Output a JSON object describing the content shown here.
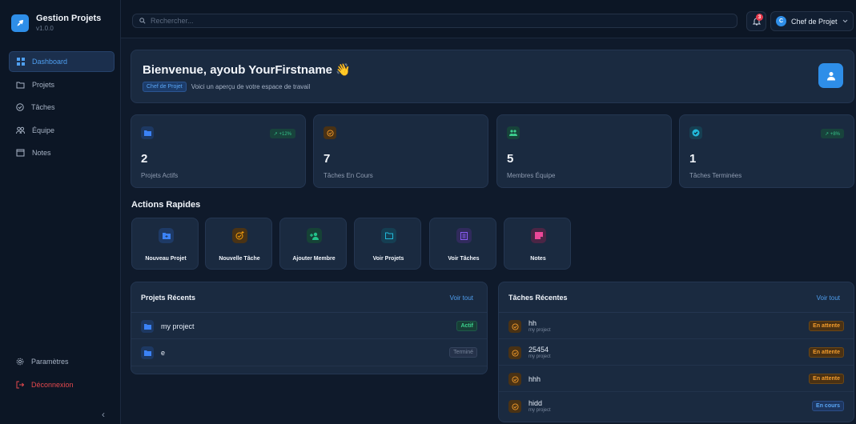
{
  "brand": {
    "title": "Gestion Projets",
    "version": "v1.0.0"
  },
  "nav": {
    "items": [
      {
        "label": "Dashboard",
        "icon": "grid-icon",
        "active": true
      },
      {
        "label": "Projets",
        "icon": "folder-icon"
      },
      {
        "label": "Tâches",
        "icon": "check-circle-icon"
      },
      {
        "label": "Équipe",
        "icon": "team-icon"
      },
      {
        "label": "Notes",
        "icon": "note-icon"
      }
    ],
    "settings": "Paramètres",
    "logout": "Déconnexion",
    "collapse": "‹"
  },
  "topbar": {
    "search_placeholder": "Rechercher...",
    "notification_count": "3",
    "user_initial": "C",
    "user_role": "Chef de Projet"
  },
  "welcome": {
    "title": "Bienvenue, ayoub YourFirstname 👋",
    "role_badge": "Chef de Projet",
    "subtitle": "Voici un aperçu de votre espace de travail"
  },
  "stats": [
    {
      "value": "2",
      "label": "Projets Actifs",
      "trend": "↗ +12%",
      "color": "#2e6fd6",
      "bg": "#1d3862"
    },
    {
      "value": "7",
      "label": "Tâches En Cours",
      "trend": "",
      "color": "#f39c2c",
      "bg": "#4a3214"
    },
    {
      "value": "5",
      "label": "Membres Équipe",
      "trend": "",
      "color": "#3ccf8e",
      "bg": "#17433a"
    },
    {
      "value": "1",
      "label": "Tâches Terminées",
      "trend": "↗ +8%",
      "color": "#22b7d8",
      "bg": "#163f52"
    }
  ],
  "quick_actions": {
    "title": "Actions Rapides",
    "items": [
      {
        "label": "Nouveau Projet",
        "icon": "folder-plus-icon",
        "color": "#3b82f6",
        "bg": "#1e3a66"
      },
      {
        "label": "Nouvelle Tâche",
        "icon": "check-plus-icon",
        "color": "#f59e0b",
        "bg": "#4a3315"
      },
      {
        "label": "Ajouter Membre",
        "icon": "user-plus-icon",
        "color": "#22c58b",
        "bg": "#164236"
      },
      {
        "label": "Voir Projets",
        "icon": "folder-icon",
        "color": "#22b7d8",
        "bg": "#153e52"
      },
      {
        "label": "Voir Tâches",
        "icon": "list-icon",
        "color": "#8b5cf6",
        "bg": "#302a5c"
      },
      {
        "label": "Notes",
        "icon": "note-icon",
        "color": "#ec4899",
        "bg": "#4b2545"
      }
    ]
  },
  "recent_projects": {
    "title": "Projets Récents",
    "link": "Voir tout",
    "items": [
      {
        "name": "my project",
        "status": "Actif"
      },
      {
        "name": "e",
        "status": "Terminé"
      }
    ]
  },
  "recent_tasks": {
    "title": "Tâches Récentes",
    "link": "Voir tout",
    "items": [
      {
        "name": "hh",
        "project": "my project",
        "status": "En attente"
      },
      {
        "name": "25454",
        "project": "my project",
        "status": "En attente"
      },
      {
        "name": "hhh",
        "project": "",
        "status": "En attente"
      },
      {
        "name": "hidd",
        "project": "my project",
        "status": "En cours"
      }
    ]
  }
}
